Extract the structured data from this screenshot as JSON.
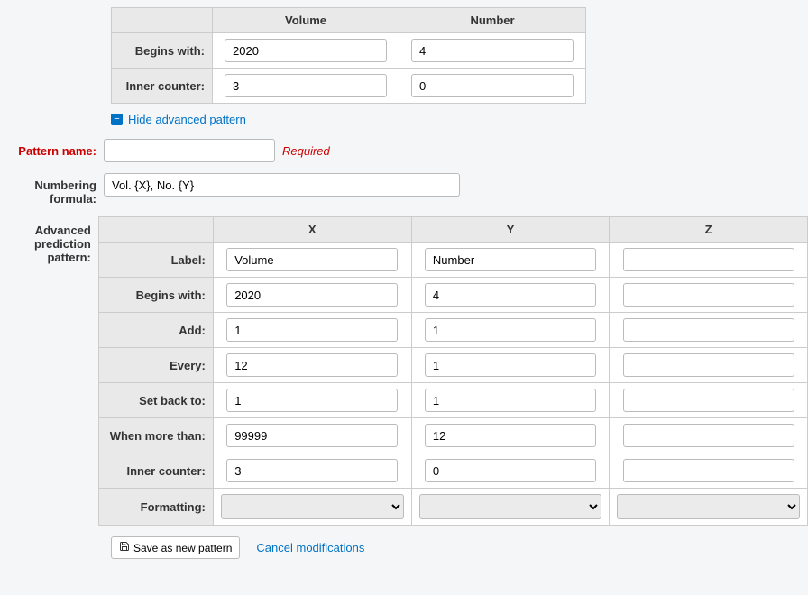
{
  "top_table": {
    "cols": [
      "Volume",
      "Number"
    ],
    "rows": [
      {
        "label": "Begins with:",
        "volume": "2020",
        "number": "4"
      },
      {
        "label": "Inner counter:",
        "volume": "3",
        "number": "0"
      }
    ]
  },
  "toggle_label": "Hide advanced pattern",
  "pattern_name": {
    "label": "Pattern name:",
    "value": "",
    "required_text": "Required"
  },
  "numbering_formula": {
    "label": "Numbering formula:",
    "value": "Vol. {X}, No. {Y}"
  },
  "advanced_label": "Advanced prediction pattern:",
  "adv_cols": [
    "X",
    "Y",
    "Z"
  ],
  "adv_rows": [
    {
      "label": "Label:",
      "x": "Volume",
      "y": "Number",
      "z": ""
    },
    {
      "label": "Begins with:",
      "x": "2020",
      "y": "4",
      "z": ""
    },
    {
      "label": "Add:",
      "x": "1",
      "y": "1",
      "z": ""
    },
    {
      "label": "Every:",
      "x": "12",
      "y": "1",
      "z": ""
    },
    {
      "label": "Set back to:",
      "x": "1",
      "y": "1",
      "z": ""
    },
    {
      "label": "When more than:",
      "x": "99999",
      "y": "12",
      "z": ""
    },
    {
      "label": "Inner counter:",
      "x": "3",
      "y": "0",
      "z": ""
    }
  ],
  "formatting_label": "Formatting:",
  "save_button": "Save as new pattern",
  "cancel_link": "Cancel modifications"
}
